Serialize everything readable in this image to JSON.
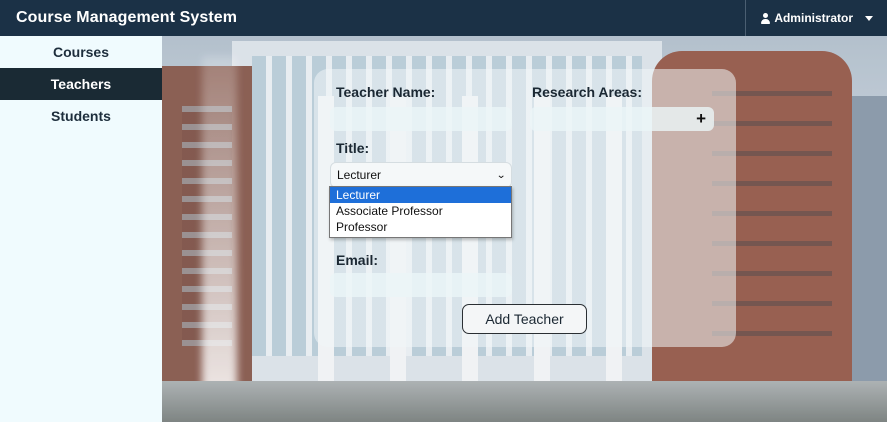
{
  "app": {
    "title": "Course Management System"
  },
  "user_menu": {
    "label": "Administrator",
    "icon": "user-icon"
  },
  "sidebar": {
    "items": [
      {
        "label": "Courses",
        "active": false
      },
      {
        "label": "Teachers",
        "active": true
      },
      {
        "label": "Students",
        "active": false
      }
    ]
  },
  "form": {
    "teacher_name_label": "Teacher Name:",
    "teacher_name_value": "",
    "research_areas_label": "Research Areas:",
    "research_add_icon": "plus-icon",
    "title_label": "Title:",
    "title_selected": "Lecturer",
    "title_options": [
      "Lecturer",
      "Associate Professor",
      "Professor"
    ],
    "email_label": "Email:",
    "email_value": "",
    "submit_label": "Add Teacher"
  },
  "colors": {
    "topbar": "#1b3146",
    "sidebar_active": "#1a2a34",
    "dropdown_highlight": "#1e6fd9"
  }
}
